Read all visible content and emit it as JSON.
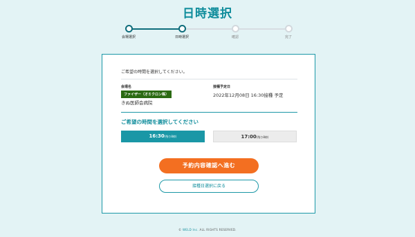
{
  "page": {
    "title": "日時選択"
  },
  "stepper": {
    "steps": [
      {
        "label": "会場選択",
        "state": "done"
      },
      {
        "label": "日時選択",
        "state": "current"
      },
      {
        "label": "確認",
        "state": "todo"
      },
      {
        "label": "完了",
        "state": "todo"
      }
    ]
  },
  "form": {
    "intro": "ご希望の時間を選択してください。",
    "venue_label": "会場名",
    "vaccine_badge": "ファイザー（オミクロン株）",
    "clinic_name": "きぬ医師会病院",
    "date_label": "接種予定日",
    "date_value": "2022年12月08日 16:30接種 予定",
    "time_heading": "ご希望の時間を選択してください",
    "slots": [
      {
        "time": "16:30",
        "remaining": "(残り8枠)",
        "selected": true
      },
      {
        "time": "17:00",
        "remaining": "(残り8枠)",
        "selected": false
      }
    ],
    "confirm_button": "予約内容確認へ進む",
    "back_button": "接種日選択に戻る"
  },
  "footer": {
    "symbol": "©",
    "brand": "WELD Inc.",
    "text": "ALL RIGHTS RESERVED."
  },
  "colors": {
    "accent": "#1a97a6",
    "primary_button": "#f36f21",
    "badge": "#2b6a12",
    "background": "#e3f3f5"
  }
}
